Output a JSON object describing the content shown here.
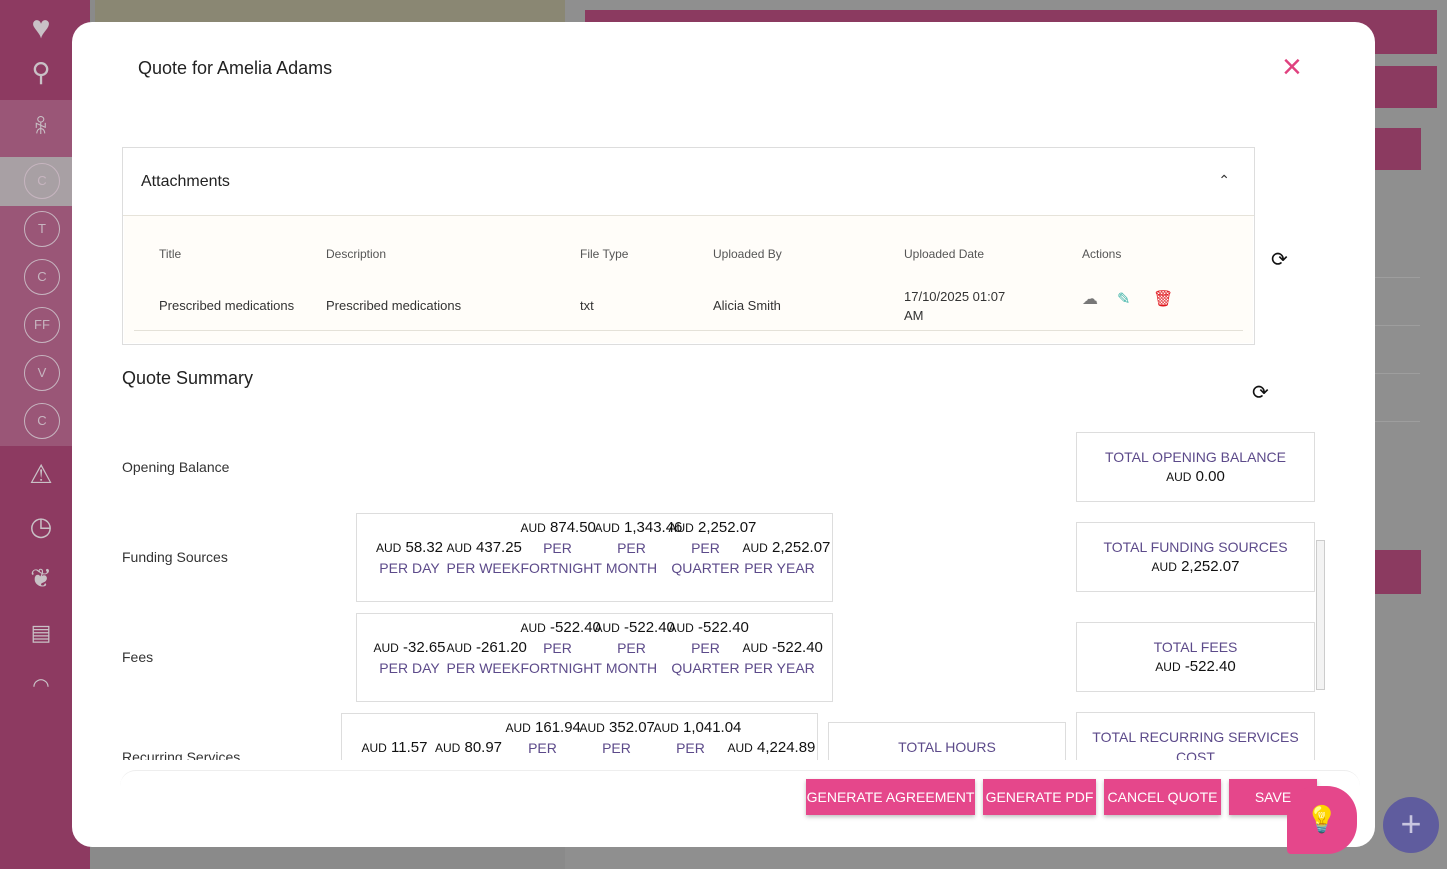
{
  "sidebar": {
    "circles": [
      "C",
      "T",
      "C",
      "FF",
      "V",
      "C"
    ]
  },
  "modal": {
    "title": "Quote for Amelia Adams",
    "close_icon": "×"
  },
  "attachments": {
    "heading": "Attachments",
    "columns": [
      "Title",
      "Description",
      "File Type",
      "Uploaded By",
      "Uploaded Date",
      "Actions"
    ],
    "rows": [
      {
        "title": "Prescribed medications",
        "description": "Prescribed medications",
        "file_type": "txt",
        "uploaded_by": "Alicia Smith",
        "uploaded_date": "17/10/2025 01:07",
        "uploaded_time": "AM"
      }
    ]
  },
  "summary": {
    "heading": "Quote Summary",
    "currency": "AUD",
    "periods": [
      [
        "PER DAY"
      ],
      [
        "PER WEEK"
      ],
      [
        "PER",
        "FORTNIGHT"
      ],
      [
        "PER",
        "MONTH"
      ],
      [
        "PER",
        "QUARTER"
      ],
      [
        "PER YEAR"
      ]
    ],
    "opening": {
      "label": "Opening Balance",
      "total_label": "TOTAL OPENING BALANCE",
      "total": "0.00"
    },
    "funding": {
      "label": "Funding Sources",
      "values": [
        "58.32",
        "437.25",
        "874.50",
        "1,343.46",
        "2,252.07",
        "2,252.07"
      ],
      "total_label": "TOTAL FUNDING SOURCES",
      "total": "2,252.07"
    },
    "fees": {
      "label": "Fees",
      "values": [
        "-32.65",
        "-261.20",
        "-522.40",
        "-522.40",
        "-522.40",
        "-522.40"
      ],
      "total_label": "TOTAL FEES",
      "total": "-522.40"
    },
    "recurring": {
      "label": "Recurring Services",
      "values": [
        "11.57",
        "80.97",
        "161.94",
        "352.07",
        "1,041.04",
        "4,224.89"
      ],
      "hours_label": "TOTAL HOURS",
      "total_label": "TOTAL RECURRING SERVICES COST"
    }
  },
  "footer": {
    "generate_agreement": "GENERATE AGREEMENT",
    "generate_pdf": "GENERATE PDF",
    "cancel_quote": "CANCEL QUOTE",
    "save": "SAVE"
  },
  "colors": {
    "accent": "#e5478b",
    "brand": "#8d3a61",
    "label": "#5c4a8a"
  }
}
